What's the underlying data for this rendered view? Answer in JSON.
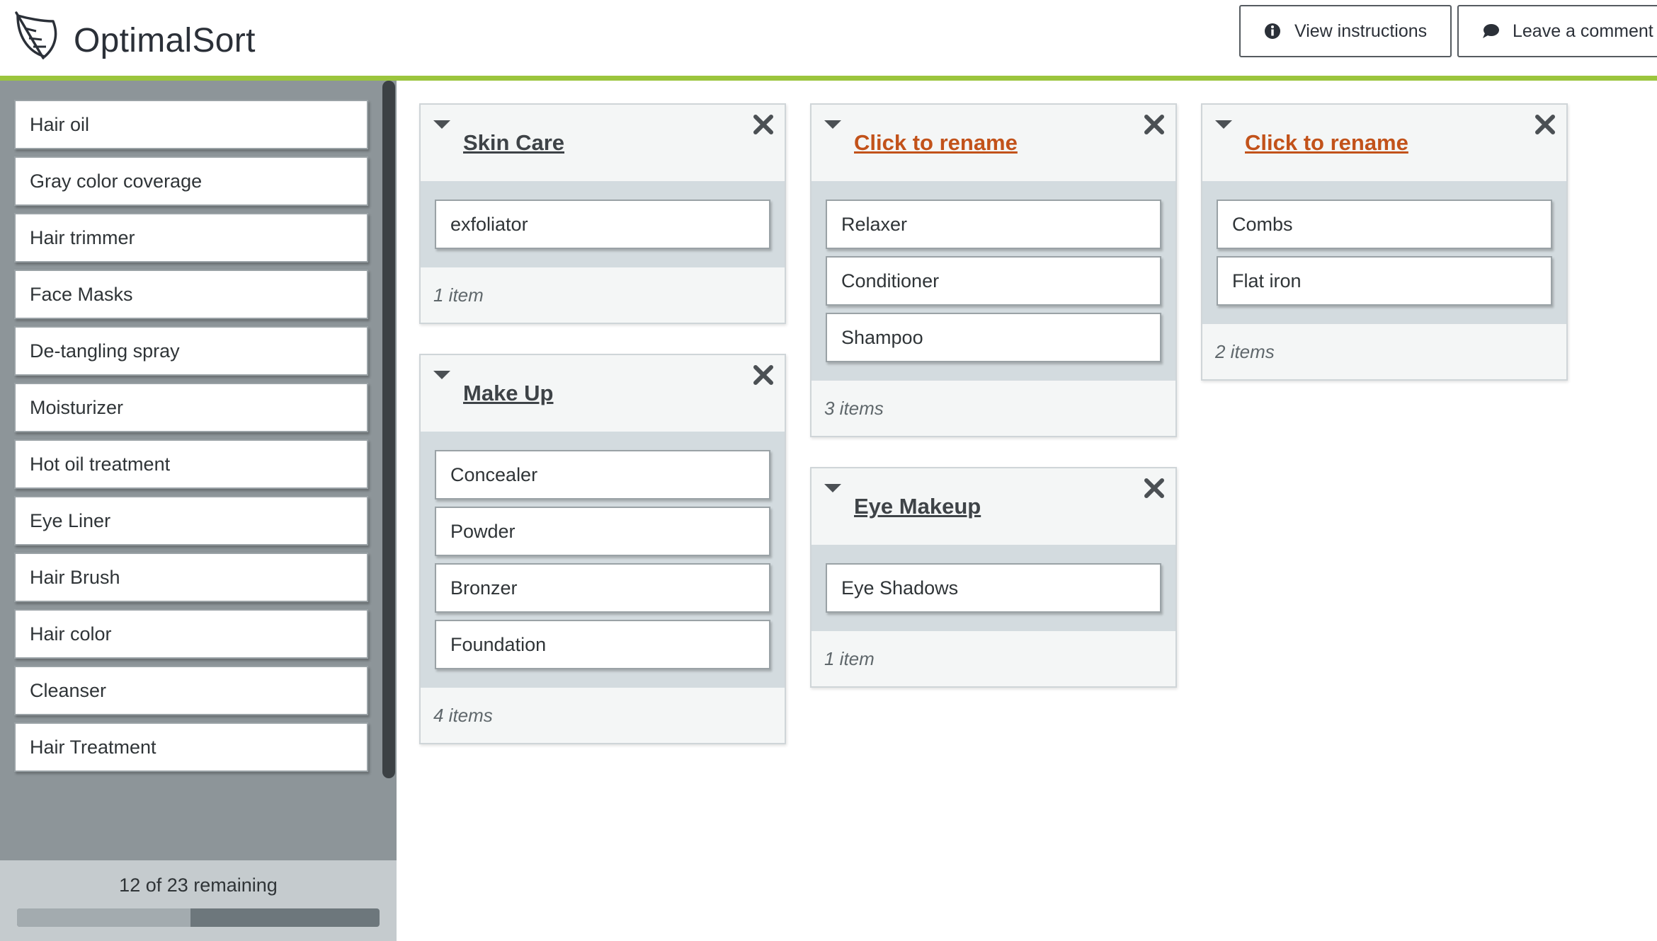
{
  "app": {
    "brand": "OptimalSort"
  },
  "header": {
    "view_instructions": "View instructions",
    "leave_comment": "Leave a comment"
  },
  "sidebar": {
    "cards": [
      "Hair oil",
      "Gray color coverage",
      "Hair trimmer",
      "Face Masks",
      "De-tangling spray",
      "Moisturizer",
      "Hot oil treatment",
      "Eye Liner",
      "Hair Brush",
      "Hair color",
      "Cleanser",
      "Hair Treatment"
    ],
    "remaining_text": "12 of 23 remaining",
    "progress_fraction": 0.478
  },
  "categories": [
    {
      "title": "Skin Care",
      "rename": false,
      "items": [
        "exfoliator"
      ],
      "count": "1 item"
    },
    {
      "title": "Make Up",
      "rename": false,
      "items": [
        "Concealer",
        "Powder",
        "Bronzer",
        "Foundation"
      ],
      "count": "4 items"
    },
    {
      "title": "Click to rename",
      "rename": true,
      "items": [
        "Relaxer",
        "Conditioner",
        "Shampoo"
      ],
      "count": "3 items"
    },
    {
      "title": "Eye Makeup",
      "rename": false,
      "items": [
        "Eye Shadows"
      ],
      "count": "1 item"
    },
    {
      "title": "Click to rename",
      "rename": true,
      "items": [
        "Combs",
        "Flat iron"
      ],
      "count": "2 items"
    }
  ],
  "colors": {
    "accent_green": "#9bc53d",
    "rename_orange": "#c2521a",
    "sidebar_bg": "#8d9599"
  }
}
